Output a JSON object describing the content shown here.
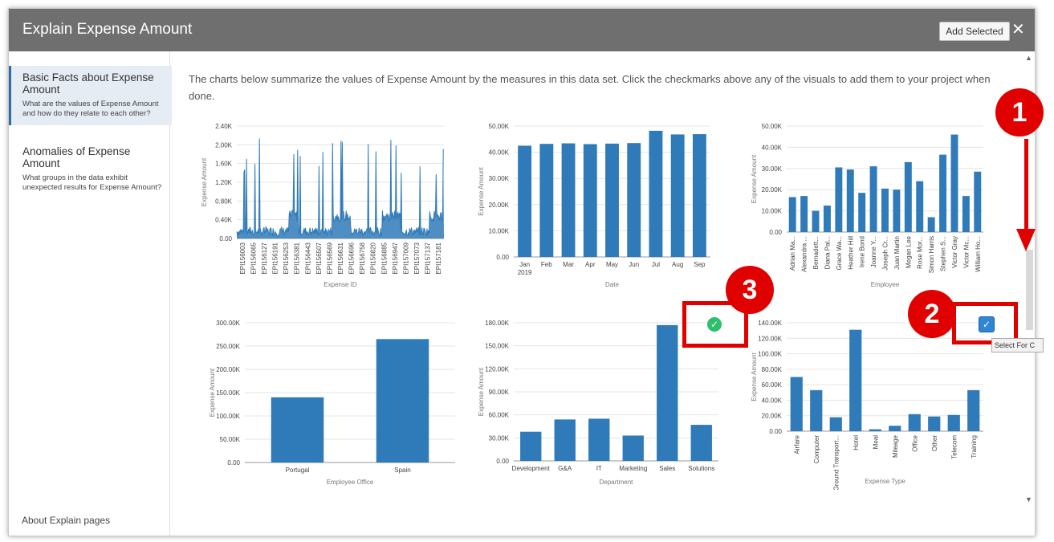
{
  "dialog": {
    "title": "Explain Expense Amount",
    "add_selected_label": "Add Selected",
    "close_glyph": "✕"
  },
  "sidebar": {
    "items": [
      {
        "title": "Basic Facts about Expense Amount",
        "desc": "What are the values of Expense Amount and how do they relate to each other?"
      },
      {
        "title": "Anomalies of Expense Amount",
        "desc": "What groups in the data exhibit unexpected results for Expense Amount?"
      }
    ],
    "about_label": "About Explain pages"
  },
  "intro_text": "The charts below summarize the values of Expense Amount by the measures in this data set. Click the checkmarks above any of the visuals to add them to your project when done.",
  "annotations": {
    "badge1": "1",
    "badge2": "2",
    "badge3": "3",
    "tooltip": "Select For C",
    "check_glyph": "✓",
    "accent": "#e10000"
  },
  "colors": {
    "bar": "#2f7ab8",
    "titlebar": "#6f6f6f"
  },
  "chart_data": [
    {
      "type": "line",
      "xlabel": "Expense ID",
      "ylabel": "Expense Amount",
      "yticks": [
        "0.00",
        "0.40K",
        "0.80K",
        "1.20K",
        "1.60K",
        "2.00K",
        "2.40K"
      ],
      "ylim": [
        0,
        2400
      ],
      "categories": [
        "EPI156003",
        "EPI156065",
        "EPI156127",
        "EPI156191",
        "EPI156253",
        "EPI156381",
        "EPI156443",
        "EPI156507",
        "EPI156569",
        "EPI156631",
        "EPI156696",
        "EPI156758",
        "EPI156820",
        "EPI156885",
        "EPI156947",
        "EPI157009",
        "EPI157073",
        "EPI157137",
        "EPI157181"
      ]
    },
    {
      "type": "bar",
      "xlabel": "Date",
      "ylabel": "Expense Amount",
      "yticks": [
        "0.00",
        "10.00K",
        "20.00K",
        "30.00K",
        "40.00K",
        "50.00K"
      ],
      "ylim": [
        0,
        50000
      ],
      "categories": [
        "Jan",
        "Feb",
        "Mar",
        "Apr",
        "May",
        "Jun",
        "Jul",
        "Aug",
        "Sep"
      ],
      "sublabel": "2019",
      "values": [
        42500,
        43200,
        43400,
        43100,
        43300,
        43500,
        48200,
        46800,
        46900
      ]
    },
    {
      "type": "bar",
      "xlabel": "Employee",
      "ylabel": "Expense Amount",
      "yticks": [
        "0.00",
        "10.00K",
        "20.00K",
        "30.00K",
        "40.00K",
        "50.00K"
      ],
      "ylim": [
        0,
        50000
      ],
      "categories": [
        "Adrian Ma...",
        "Alexandra ...",
        "Bernadett...",
        "Diana Pal...",
        "Grace Wa...",
        "Heather Hill",
        "Irene Bond",
        "Joanne Y...",
        "Joseph Cr...",
        "Juan Martin",
        "Megan Lee",
        "Rose Mor...",
        "Simon Harris",
        "Stephen S...",
        "Victor Gray",
        "Victor Mc...",
        "William Ho..."
      ],
      "values": [
        16500,
        17000,
        10000,
        12500,
        30500,
        29500,
        18500,
        31000,
        20500,
        20000,
        33000,
        24000,
        7000,
        36500,
        46000,
        17000,
        28500
      ]
    },
    {
      "type": "bar",
      "xlabel": "Employee Office",
      "ylabel": "Expense Amount",
      "yticks": [
        "0.00",
        "50.00K",
        "100.00K",
        "150.00K",
        "200.00K",
        "250.00K",
        "300.00K"
      ],
      "ylim": [
        0,
        300000
      ],
      "categories": [
        "Portugal",
        "Spain"
      ],
      "values": [
        140000,
        265000
      ]
    },
    {
      "type": "bar",
      "xlabel": "Department",
      "ylabel": "Expense Amount",
      "yticks": [
        "0.00",
        "30.00K",
        "60.00K",
        "90.00K",
        "120.00K",
        "150.00K",
        "180.00K"
      ],
      "ylim": [
        0,
        180000
      ],
      "categories": [
        "Development",
        "G&A",
        "IT",
        "Marketing",
        "Sales",
        "Solutions"
      ],
      "values": [
        38000,
        54000,
        55000,
        33000,
        177000,
        47000
      ]
    },
    {
      "type": "bar",
      "xlabel": "Expense Type",
      "ylabel": "Expense Amount",
      "yticks": [
        "0.00",
        "20.00K",
        "40.00K",
        "60.00K",
        "80.00K",
        "100.00K",
        "120.00K",
        "140.00K"
      ],
      "ylim": [
        0,
        140000
      ],
      "categories": [
        "Airfare",
        "Computer",
        "Ground Transport...",
        "Hotel",
        "Meal",
        "Mileage",
        "Office",
        "Other",
        "Telecom",
        "Training"
      ],
      "values": [
        70000,
        53000,
        18000,
        131000,
        2500,
        7000,
        22000,
        19000,
        21000,
        53000
      ]
    }
  ]
}
